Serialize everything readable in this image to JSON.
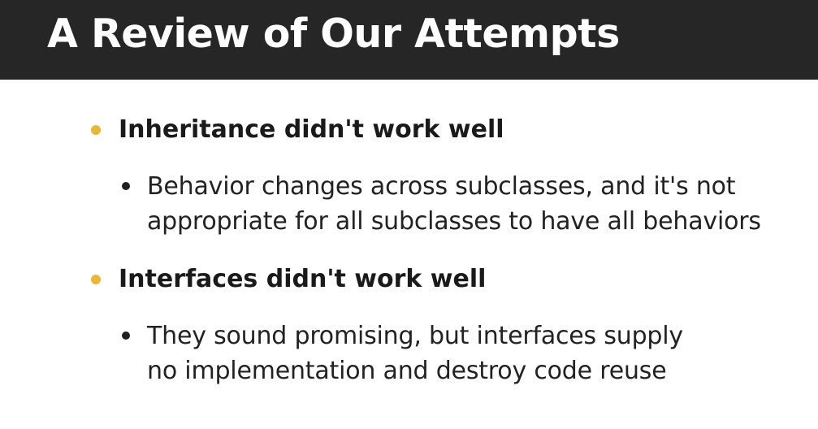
{
  "slide": {
    "title": "A Review of Our Attempts",
    "bullet_color": "#e8b83a",
    "bullets": [
      {
        "text": "Inheritance didn't work well",
        "sub": [
          {
            "line1": "Behavior changes across subclasses, and it's not",
            "line2": "appropriate for all subclasses to have all behaviors"
          }
        ]
      },
      {
        "text": "Interfaces didn't work well",
        "sub": [
          {
            "line1": "They sound promising, but interfaces supply",
            "line2": "no implementation and destroy code reuse"
          }
        ]
      }
    ]
  }
}
